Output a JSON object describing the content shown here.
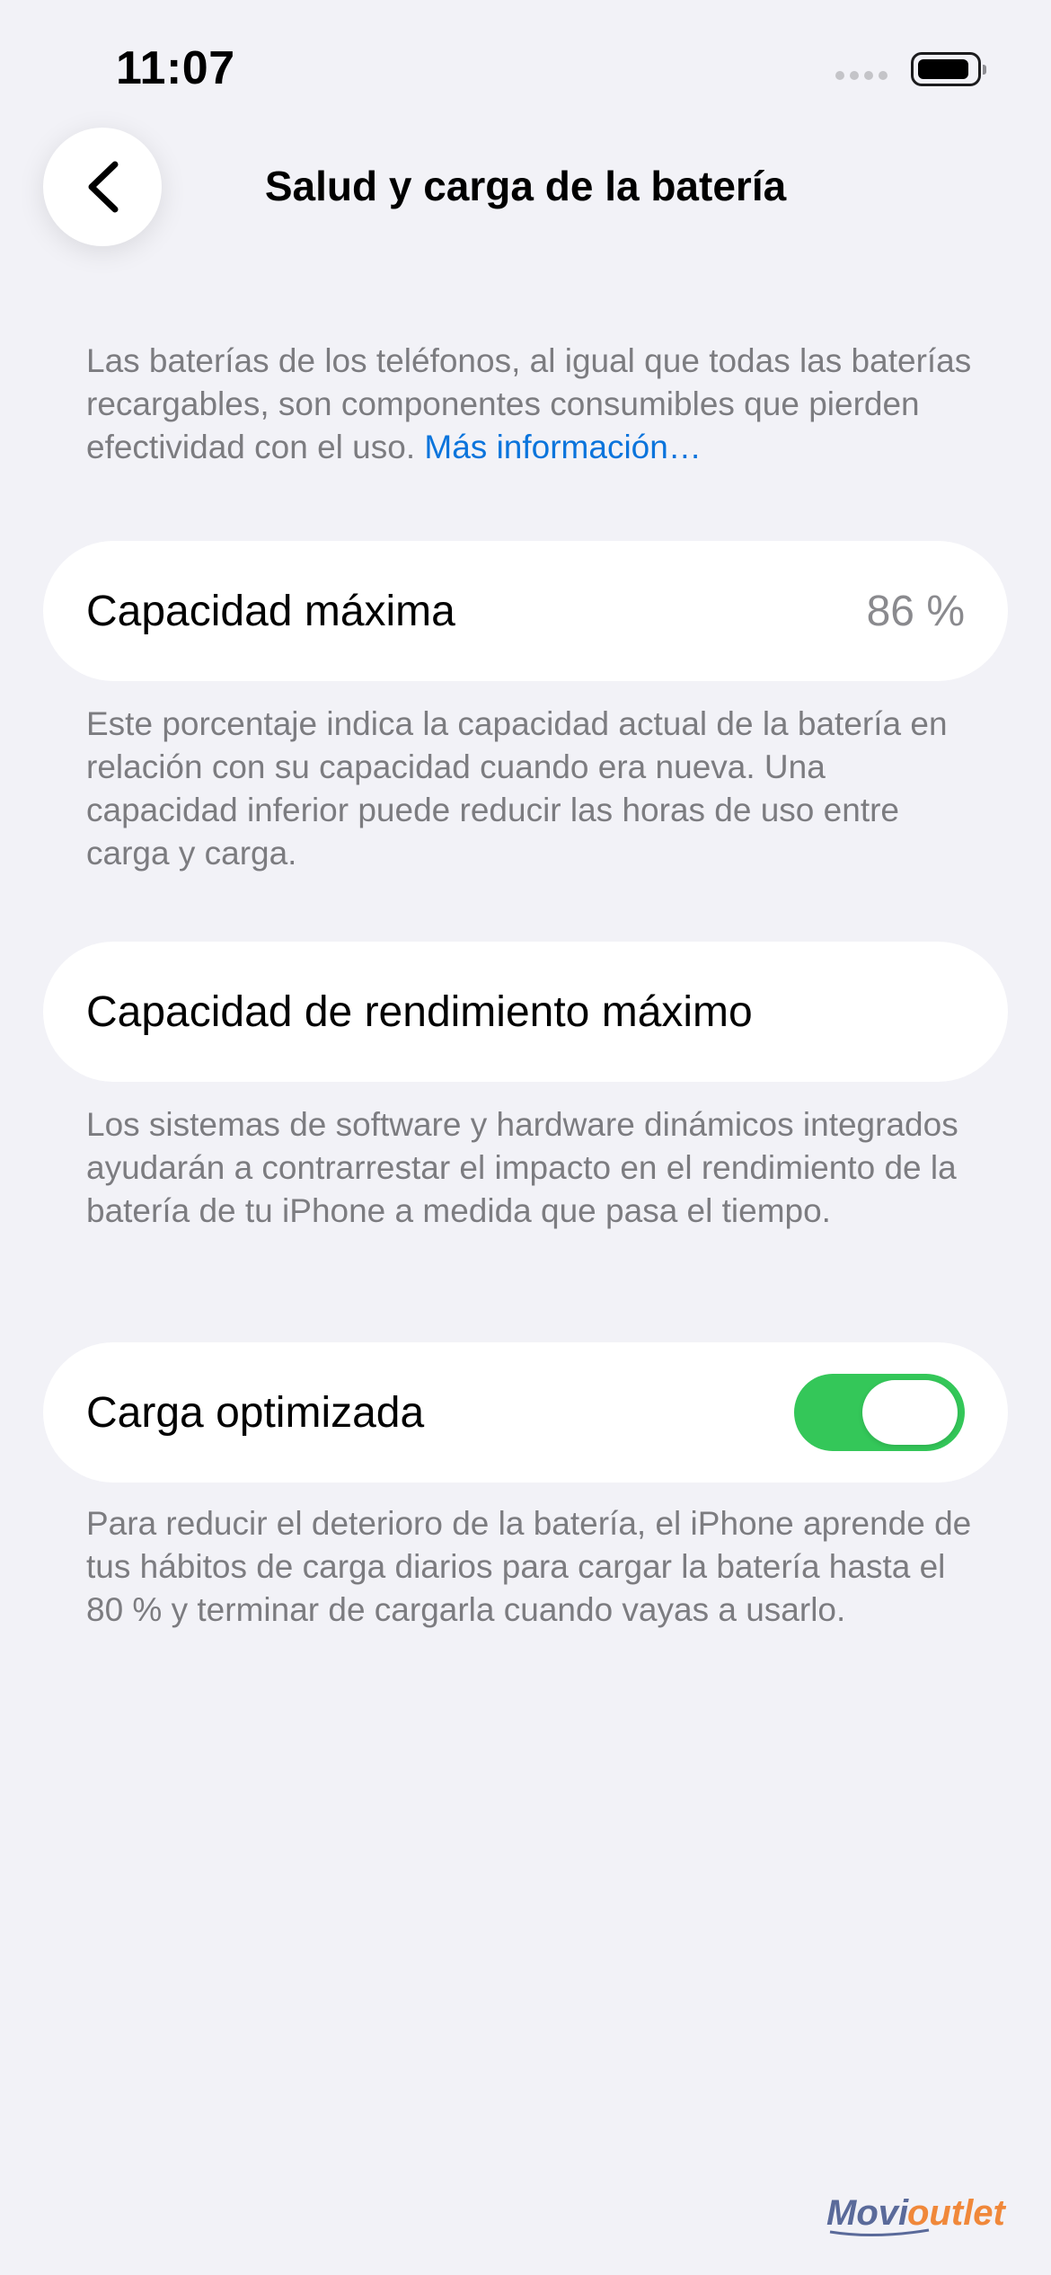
{
  "status_bar": {
    "time": "11:07",
    "battery_level": 0.9
  },
  "header": {
    "title": "Salud y carga de la batería"
  },
  "intro": {
    "text": "Las baterías de los teléfonos, al igual que todas las baterías recargables, son componentes consumibles que pierden efectividad con el uso.",
    "link_label": "Más información…"
  },
  "max_capacity": {
    "label": "Capacidad máxima",
    "value": "86 %",
    "footnote": "Este porcentaje indica la capacidad actual de la batería en relación con su capacidad cuando era nueva. Una capacidad inferior puede reducir las horas de uso entre carga y carga."
  },
  "peak_performance": {
    "label": "Capacidad de rendimiento máximo",
    "footnote": "Los sistemas de software y hardware dinámicos integrados ayudarán a contrarrestar el impacto en el rendimiento de la batería de tu iPhone a medida que pasa el tiempo."
  },
  "optimized_charging": {
    "label": "Carga optimizada",
    "enabled": true,
    "footnote": "Para reducir el deterioro de la batería, el iPhone aprende de tus hábitos de carga diarios para cargar la batería hasta el 80 % y terminar de cargarla cuando vayas a usarlo."
  },
  "watermark": {
    "text": "Movioutlet"
  },
  "colors": {
    "background": "#f2f2f7",
    "link": "#0a74dc",
    "toggle_on": "#34c759",
    "secondary_text": "#7c7c80"
  }
}
